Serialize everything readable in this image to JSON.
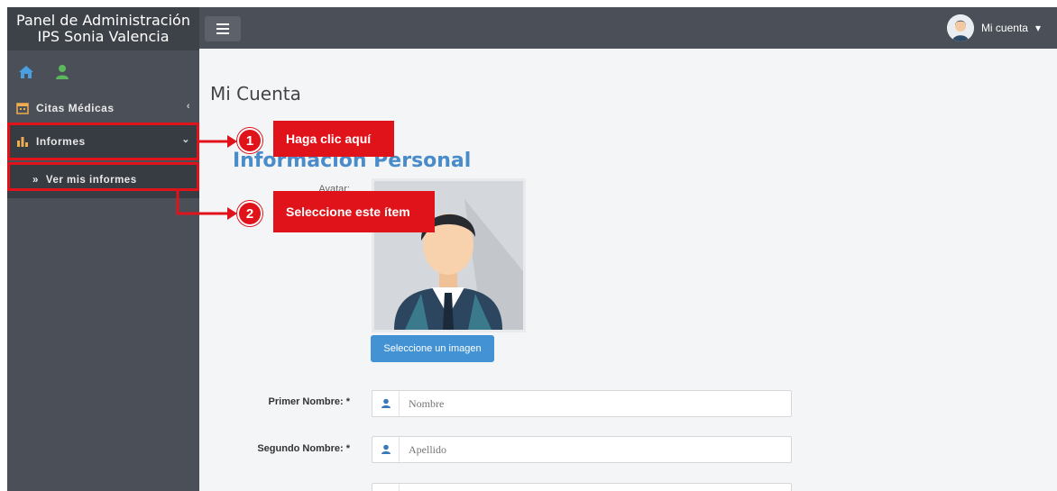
{
  "sidebar": {
    "brand_line1": "Panel de Administración",
    "brand_line2": "IPS Sonia Valencia",
    "quick_icons": [
      "home-icon",
      "user-icon"
    ],
    "items": [
      {
        "label": "Citas Médicas",
        "icon": "calendar-icon",
        "chevron": "‹"
      },
      {
        "label": "Informes",
        "icon": "bar-chart-icon",
        "chevron": "⌄"
      },
      {
        "label": "Ver mis informes",
        "icon": "double-chevron-right-icon",
        "prefix": "»"
      }
    ]
  },
  "topbar": {
    "menu_icon": "hamburger-icon",
    "account_label": "Mi cuenta",
    "account_caret": "▾"
  },
  "main": {
    "page_title": "Mi Cuenta",
    "section_title": "Información Personal",
    "avatar_label": "Avatar:",
    "upload_button": "Seleccione un imagen",
    "fields": [
      {
        "label": "Primer Nombre: *",
        "placeholder": "Nombre",
        "icon": "user-icon"
      },
      {
        "label": "Segundo Nombre: *",
        "placeholder": "Apellido",
        "icon": "user-icon"
      },
      {
        "label": "",
        "placeholder": "",
        "icon": "calendar-icon"
      }
    ]
  },
  "annotations": {
    "step1_number": "1",
    "step1_text": "Haga clic aquí",
    "step2_number": "2",
    "step2_text": "Seleccione este ítem",
    "color": "#e0131b"
  },
  "colors": {
    "sidebar": "#4b5058",
    "accent_blue": "#4393d4",
    "section_title": "#4a8bc9"
  }
}
